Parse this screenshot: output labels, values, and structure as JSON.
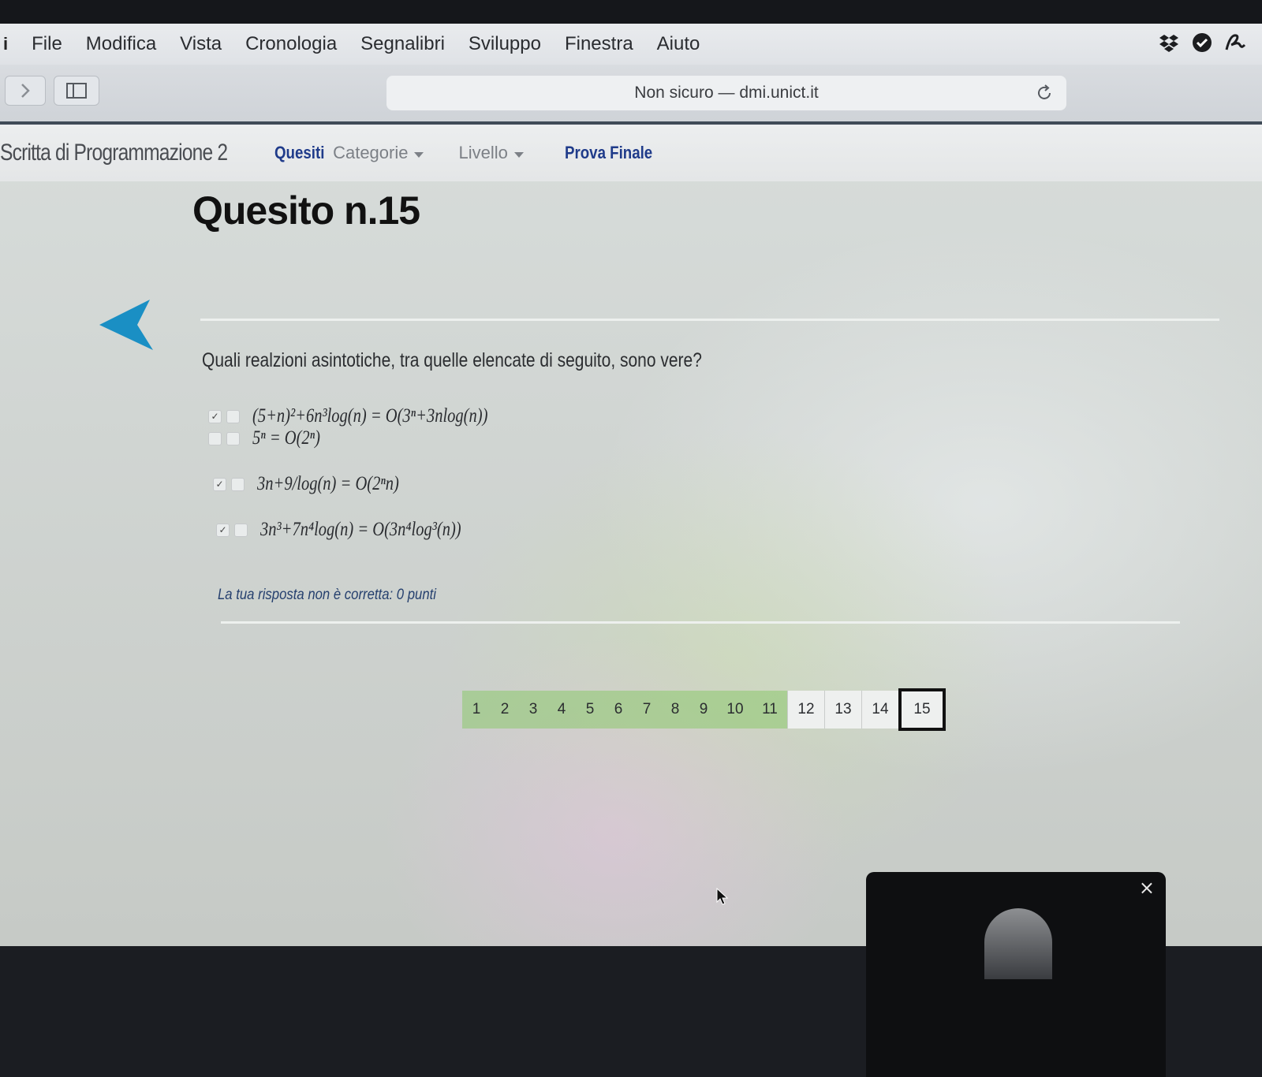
{
  "menubar": {
    "items": [
      "File",
      "Modifica",
      "Vista",
      "Cronologia",
      "Segnalibri",
      "Sviluppo",
      "Finestra",
      "Aiuto"
    ]
  },
  "toolbar": {
    "address": "Non sicuro — dmi.unict.it"
  },
  "site_nav": {
    "brand": "Scritta di Programmazione 2",
    "links": [
      "Quesiti",
      "Categorie",
      "Livello",
      "Prova Finale"
    ]
  },
  "main": {
    "title": "Quesito n.15",
    "question": "Quali realzioni asintotiche, tra quelle elencate di seguito, sono vere?",
    "options": [
      {
        "formula": "(5+n)²+6n³log(n) = O(3ⁿ+3nlog(n))",
        "checked": true
      },
      {
        "formula": "5ⁿ = O(2ⁿ)",
        "checked": false
      },
      {
        "formula": "3n+9/log(n) = O(2ⁿn)",
        "checked": true
      },
      {
        "formula": "3n³+7n⁴log(n) = O(3n⁴log³(n))",
        "checked": true
      }
    ],
    "check_glyph": "✓",
    "feedback": "La tua risposta non è corretta: 0 punti"
  },
  "pagination": {
    "pages": [
      "1",
      "2",
      "3",
      "4",
      "5",
      "6",
      "7",
      "8",
      "9",
      "10",
      "11",
      "12",
      "13",
      "14",
      "15"
    ],
    "answered_through": 11,
    "current": "15",
    "answered_color": "#8cc86e"
  },
  "pip": {
    "close_glyph": "×"
  },
  "colors": {
    "accent_blue": "#1f3b8a",
    "back_arrow": "#1a8fc4"
  }
}
